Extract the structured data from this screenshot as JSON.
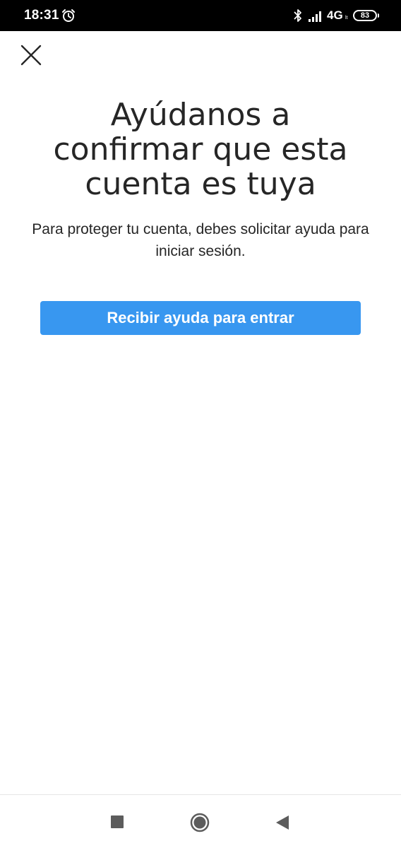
{
  "status_bar": {
    "time": "18:31",
    "network": "4G",
    "network_sub": "lt",
    "battery": "83",
    "icons": [
      "alarm-icon",
      "bluetooth-icon",
      "signal-icon",
      "battery-icon"
    ]
  },
  "header": {
    "close_icon": "close-icon"
  },
  "main": {
    "title": "Ayúdanos a confirmar que esta cuenta es tuya",
    "description": "Para proteger tu cuenta, debes solicitar ayuda para iniciar sesión.",
    "help_button_label": "Recibir ayuda para entrar"
  },
  "colors": {
    "accent": "#3897f0",
    "text": "#262626",
    "status_bar_bg": "#000000"
  },
  "nav_bar": {
    "icons": [
      "recent-apps-icon",
      "home-icon",
      "back-icon"
    ]
  }
}
